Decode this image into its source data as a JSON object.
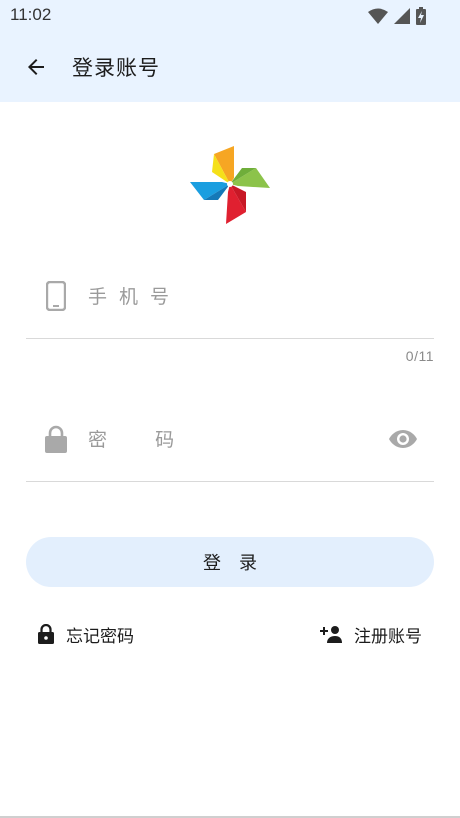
{
  "status_bar": {
    "time": "11:02",
    "icons": [
      "wifi-icon",
      "signal-icon",
      "battery-charging-icon"
    ]
  },
  "app_bar": {
    "title": "登录账号",
    "back_icon": "arrow-left-icon"
  },
  "logo": {
    "icon": "pinwheel-logo",
    "colors": [
      "#f6a623",
      "#8cc34a",
      "#e02030",
      "#1a9ee0",
      "#f5e01a"
    ]
  },
  "form": {
    "phone": {
      "placeholder": "手机号",
      "value": "",
      "counter": "0/11",
      "icon": "phone-icon"
    },
    "password": {
      "placeholder": "密  码",
      "value": "",
      "icon": "lock-icon",
      "toggle_icon": "eye-icon"
    },
    "login_label": "登录"
  },
  "links": {
    "forgot": {
      "label": "忘记密码",
      "icon": "lock-icon"
    },
    "register": {
      "label": "注册账号",
      "icon": "add-person-icon"
    }
  },
  "colors": {
    "header_bg": "#e9f3ff",
    "button_bg": "#e3effd",
    "icon_gray": "#a9a9a9"
  }
}
